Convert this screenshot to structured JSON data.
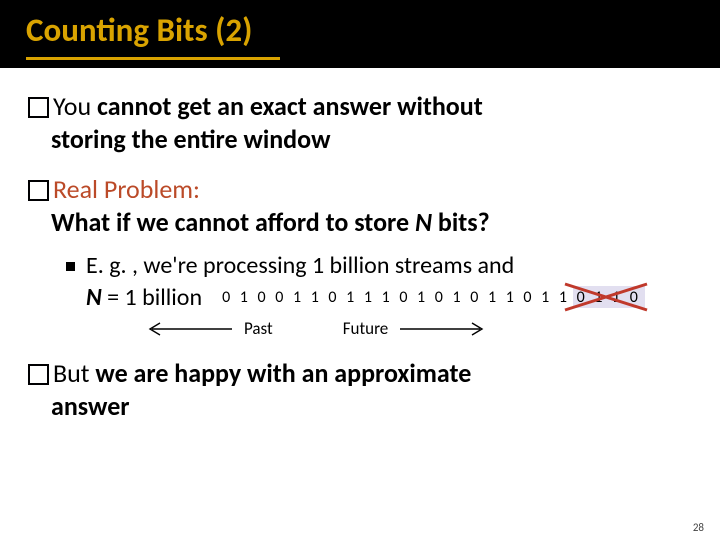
{
  "title": "Counting Bits (2)",
  "bullets": {
    "b1": {
      "lead": "You",
      "rest": " cannot get an exact answer without",
      "cont": "storing the entire window"
    },
    "b2": {
      "lead": "Real",
      "rest": " Problem:",
      "q": "What if we cannot afford to store ",
      "nvar": "N",
      "qend": " bits?"
    },
    "sub": {
      "l1": "E. g. , we're processing 1 billion streams and",
      "nvar": "N",
      "eq": "  = 1 billion"
    },
    "b3": {
      "lead": "But",
      "rest": " we are happy with an approximate",
      "cont": "answer"
    }
  },
  "bits": "0 1 0 0 1 1 0 1 1 1 0 1 0 1 0 1 1 0 1 1 0 1 1 0",
  "arrows": {
    "past": "Past",
    "future": "Future"
  },
  "page": "28"
}
